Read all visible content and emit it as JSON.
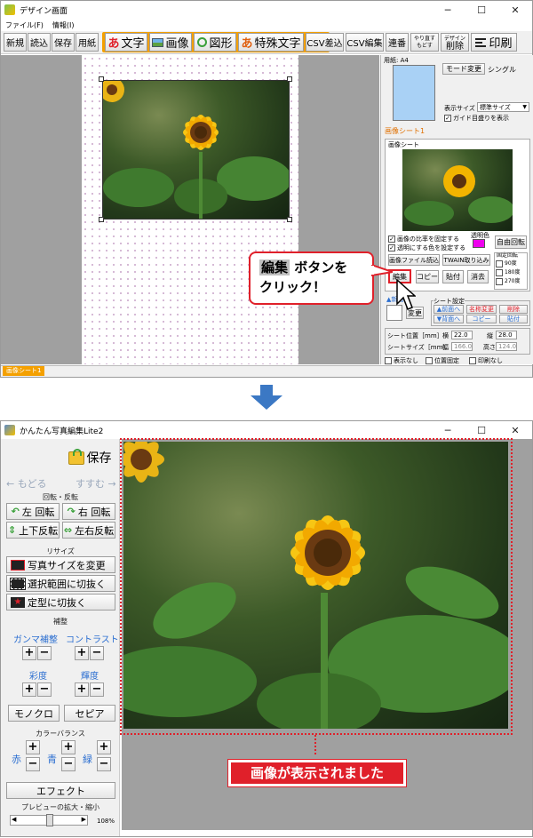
{
  "top": {
    "title": "デザイン画面",
    "menu": [
      "ファイル(F)",
      "情報(I)"
    ],
    "window_buttons": [
      "─",
      "☐",
      "✕"
    ],
    "toolbar": {
      "new": "新規",
      "open": "読込",
      "save": "保存",
      "paper": "用紙",
      "text_prefix": "あ",
      "text": "文字",
      "image": "画像",
      "shape": "図形",
      "special_prefix": "あ",
      "special": "特殊文字",
      "csv_insert": "CSV差込",
      "csv_edit": "CSV編集",
      "series": "連番",
      "redo": "やり直す",
      "undo": "もどす",
      "design": "デザイン",
      "delete": "削除",
      "print": "印刷"
    },
    "paper": {
      "size_label": "用紙: A4",
      "mode_change": "モード変更",
      "mode_value": "シングル",
      "display_size_label": "表示サイズ",
      "display_size_value": "標準サイズ",
      "guide_label": "ガイド目盛りを表示"
    },
    "image_sheet_title": "画像シート1",
    "image_sheet_group": "画像シート",
    "keep_ratio": "画像の比率を固定する",
    "set_transparent": "透明にする色を設定する",
    "transparent_color_label": "透明色",
    "free_rotate": "自由回転",
    "load_image_file": "画像ファイル読込",
    "twain": "TWAIN取り込み",
    "fixed_rotate_label": "固定回転",
    "rotate_options": [
      "90度",
      "180度",
      "270度"
    ],
    "edit": "編集",
    "copy": "コピー",
    "paste": "貼付",
    "clear": "消去",
    "new_sheet": "▲新画",
    "change": "変更",
    "sheet_settings": "シート設定",
    "sheet_front": "▲前面へ",
    "sheet_back": "▼背面へ",
    "name_change": "名称変更",
    "sheet_copy": "コピー",
    "sheet_delete": "削除",
    "sheet_paste": "貼付",
    "sheet_pos_label": "シート位置［mm］",
    "pos_x_label": "横",
    "pos_x": "22.0",
    "pos_y_label": "縦",
    "pos_y": "28.0",
    "sheet_size_label": "シートサイズ［mm］",
    "width_label": "幅",
    "width": "166.0",
    "height_label": "高さ",
    "height": "124.0",
    "hide": "表示なし",
    "fix_pos": "位置固定",
    "no_print": "印刷なし",
    "status_tab": "画像シート1"
  },
  "callout": {
    "highlight": "編集",
    "line1_rest": " ボタンを",
    "line2": "クリック！"
  },
  "bottom": {
    "title": "かんたん写真編集Lite2",
    "window_buttons": [
      "─",
      "☐",
      "✕"
    ],
    "save": "保存",
    "back": "← もどる",
    "forward": "すすむ →",
    "rotate_section": "回転・反転",
    "rotate_left": "左 回転",
    "rotate_right": "右 回転",
    "flip_v": "上下反転",
    "flip_h": "左右反転",
    "resize_section": "リサイズ",
    "change_size": "写真サイズを変更",
    "crop_selection": "選択範囲に切抜く",
    "crop_shape": "定型に切抜く",
    "correction_section": "補整",
    "gamma": "ガンマ補整",
    "contrast": "コントラスト",
    "saturation": "彩度",
    "brightness": "輝度",
    "mono": "モノクロ",
    "sepia": "セピア",
    "color_balance": "カラーバランス",
    "red": "赤",
    "green": "青",
    "blue": "緑",
    "effect": "エフェクト",
    "preview_zoom": "プレビューの拡大・縮小",
    "zoom_value": "108%"
  },
  "note": "画像が表示されました",
  "colors": {
    "accent_orange": "#f4a000",
    "highlight_red": "#e0202a",
    "arrow_blue": "#3b78c4",
    "link_blue": "#2c6fd1"
  }
}
